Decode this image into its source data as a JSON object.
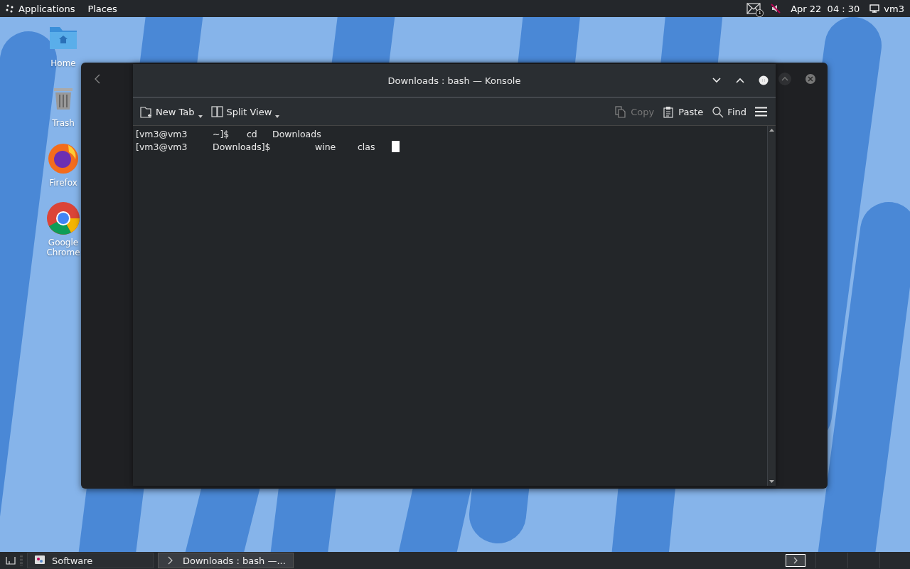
{
  "top_panel": {
    "menus": [
      {
        "label": "Applications",
        "kind": "apps"
      },
      {
        "label": "Places",
        "kind": "plain"
      }
    ],
    "mail_badge": "1",
    "clock": "Apr 22  04 : 30",
    "user": "vm3"
  },
  "desktop_icons": [
    {
      "label": "Home",
      "kind": "folder"
    },
    {
      "label": "Trash",
      "kind": "trash"
    },
    {
      "label": "Firefox",
      "kind": "firefox"
    },
    {
      "label": "Google Chrome",
      "kind": "chrome"
    }
  ],
  "konsole": {
    "title": "Downloads : bash — Konsole",
    "toolbar": [
      {
        "label": "New Tab",
        "kind": "newtab",
        "menu": true,
        "disabled": false
      },
      {
        "label": "Split View",
        "kind": "split",
        "menu": true,
        "disabled": false
      },
      {
        "label": "Copy",
        "kind": "copy",
        "menu": false,
        "disabled": true
      },
      {
        "label": "Paste",
        "kind": "paste",
        "menu": false,
        "disabled": false
      },
      {
        "label": "Find",
        "kind": "find",
        "menu": false,
        "disabled": false
      }
    ],
    "lines": [
      {
        "tokens": [
          "[vm3@vm3",
          "~]$",
          "cd",
          "Downloads"
        ],
        "cursor": false
      },
      {
        "tokens": [
          "[vm3@vm3",
          "Downloads]$",
          "wine",
          "clas"
        ],
        "cursor": true
      }
    ]
  },
  "taskbar": {
    "tasks": [
      {
        "label": "Software",
        "kind": "software",
        "selected": false
      },
      {
        "label": "Downloads : bash —...",
        "kind": "terminal",
        "selected": true
      }
    ]
  }
}
